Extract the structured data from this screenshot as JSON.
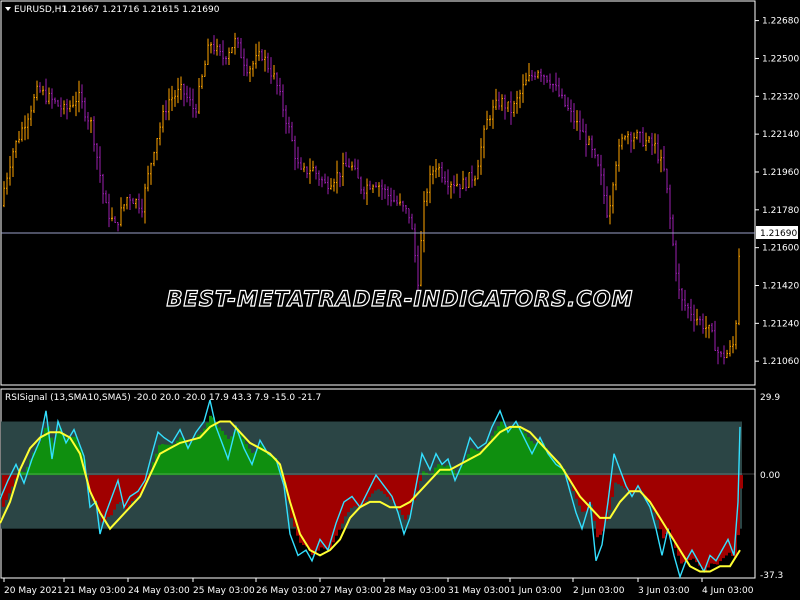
{
  "price_panel": {
    "symbol_title": "EURUSD,H1",
    "ohlc": "1.21667 1.21716 1.21615 1.21690",
    "current_price": "1.21690",
    "y_ticks": [
      "1.22680",
      "1.22500",
      "1.22320",
      "1.22140",
      "1.21960",
      "1.21780",
      "1.21600",
      "1.21420",
      "1.21240",
      "1.21060"
    ]
  },
  "indicator_panel": {
    "title": "RSISignal (13,SMA10,SMA5) -20.0 20.0 -20.0 17.9 43.3 7.9 -15.0 -21.7",
    "y_ticks": [
      "29.9",
      "0.00",
      "-37.3"
    ]
  },
  "time_axis": {
    "labels": [
      "20 May 2021",
      "21 May 03:00",
      "24 May 03:00",
      "25 May 03:00",
      "26 May 03:00",
      "27 May 03:00",
      "28 May 03:00",
      "31 May 03:00",
      "1 Jun 03:00",
      "2 Jun 03:00",
      "3 Jun 03:00",
      "4 Jun 03:00"
    ]
  },
  "watermark": "BEST-METATRADER-INDICATORS.COM",
  "colors": {
    "bull_bar": "#ffa500",
    "bear_bar": "#9b1fb0",
    "rsi_line": "#33e0ff",
    "signal_line": "#ffff33",
    "hist_pos": "#0f8f0f",
    "hist_neg": "#a00000",
    "band_fill": "#2b4545",
    "grid": "#ffffff"
  },
  "chart_data": {
    "type": "line",
    "title": "EURUSD,H1",
    "y_range": [
      1.2098,
      1.2274
    ],
    "close_profile": [
      [
        0,
        1.218
      ],
      [
        12,
        1.2205
      ],
      [
        25,
        1.222
      ],
      [
        38,
        1.2235
      ],
      [
        52,
        1.223
      ],
      [
        65,
        1.2225
      ],
      [
        78,
        1.2232
      ],
      [
        92,
        1.2218
      ],
      [
        105,
        1.218
      ],
      [
        115,
        1.217
      ],
      [
        128,
        1.2185
      ],
      [
        142,
        1.218
      ],
      [
        155,
        1.221
      ],
      [
        168,
        1.223
      ],
      [
        182,
        1.2235
      ],
      [
        195,
        1.2225
      ],
      [
        210,
        1.2258
      ],
      [
        222,
        1.225
      ],
      [
        235,
        1.2258
      ],
      [
        248,
        1.2245
      ],
      [
        262,
        1.2252
      ],
      [
        275,
        1.224
      ],
      [
        288,
        1.2218
      ],
      [
        300,
        1.2195
      ],
      [
        312,
        1.2198
      ],
      [
        325,
        1.219
      ],
      [
        338,
        1.2195
      ],
      [
        350,
        1.22
      ],
      [
        362,
        1.2188
      ],
      [
        375,
        1.2192
      ],
      [
        388,
        1.2185
      ],
      [
        400,
        1.218
      ],
      [
        410,
        1.2175
      ],
      [
        418,
        1.2145
      ],
      [
        425,
        1.2185
      ],
      [
        435,
        1.22
      ],
      [
        448,
        1.2192
      ],
      [
        462,
        1.219
      ],
      [
        475,
        1.2195
      ],
      [
        488,
        1.2222
      ],
      [
        500,
        1.223
      ],
      [
        512,
        1.2225
      ],
      [
        525,
        1.2238
      ],
      [
        538,
        1.2245
      ],
      [
        550,
        1.224
      ],
      [
        562,
        1.223
      ],
      [
        575,
        1.222
      ],
      [
        588,
        1.221
      ],
      [
        600,
        1.2195
      ],
      [
        608,
        1.2175
      ],
      [
        615,
        1.22
      ],
      [
        625,
        1.2215
      ],
      [
        640,
        1.2212
      ],
      [
        655,
        1.2208
      ],
      [
        665,
        1.2195
      ],
      [
        672,
        1.2165
      ],
      [
        680,
        1.2135
      ],
      [
        690,
        1.213
      ],
      [
        700,
        1.2125
      ],
      [
        710,
        1.212
      ],
      [
        720,
        1.2108
      ],
      [
        728,
        1.211
      ],
      [
        735,
        1.2115
      ],
      [
        740,
        1.2168
      ]
    ],
    "indicator": {
      "y_range": [
        -37.3,
        29.9
      ],
      "rsi_series": [
        [
          0,
          -9
        ],
        [
          8,
          -2
        ],
        [
          16,
          4
        ],
        [
          24,
          -3
        ],
        [
          32,
          6
        ],
        [
          40,
          13
        ],
        [
          46,
          24
        ],
        [
          52,
          6
        ],
        [
          58,
          20
        ],
        [
          66,
          12
        ],
        [
          74,
          17
        ],
        [
          84,
          7
        ],
        [
          90,
          -12
        ],
        [
          96,
          -10
        ],
        [
          100,
          -22
        ],
        [
          106,
          -14
        ],
        [
          112,
          -8
        ],
        [
          118,
          -2
        ],
        [
          124,
          -12
        ],
        [
          130,
          -8
        ],
        [
          138,
          -6
        ],
        [
          145,
          -2
        ],
        [
          152,
          8
        ],
        [
          158,
          16
        ],
        [
          164,
          14
        ],
        [
          172,
          12
        ],
        [
          180,
          17
        ],
        [
          188,
          10
        ],
        [
          196,
          16
        ],
        [
          204,
          20
        ],
        [
          210,
          28
        ],
        [
          216,
          18
        ],
        [
          222,
          12
        ],
        [
          228,
          6
        ],
        [
          236,
          18
        ],
        [
          244,
          10
        ],
        [
          252,
          4
        ],
        [
          260,
          13
        ],
        [
          268,
          8
        ],
        [
          276,
          6
        ],
        [
          284,
          -4
        ],
        [
          290,
          -22
        ],
        [
          298,
          -30
        ],
        [
          306,
          -28
        ],
        [
          312,
          -32
        ],
        [
          320,
          -24
        ],
        [
          328,
          -28
        ],
        [
          336,
          -18
        ],
        [
          344,
          -10
        ],
        [
          352,
          -8
        ],
        [
          360,
          -12
        ],
        [
          368,
          -6
        ],
        [
          376,
          0
        ],
        [
          384,
          -4
        ],
        [
          392,
          -8
        ],
        [
          398,
          -14
        ],
        [
          404,
          -22
        ],
        [
          410,
          -16
        ],
        [
          416,
          -4
        ],
        [
          422,
          8
        ],
        [
          430,
          2
        ],
        [
          436,
          8
        ],
        [
          442,
          4
        ],
        [
          448,
          6
        ],
        [
          455,
          -2
        ],
        [
          462,
          4
        ],
        [
          470,
          14
        ],
        [
          478,
          10
        ],
        [
          486,
          12
        ],
        [
          492,
          18
        ],
        [
          500,
          24
        ],
        [
          508,
          16
        ],
        [
          516,
          20
        ],
        [
          524,
          14
        ],
        [
          532,
          8
        ],
        [
          540,
          14
        ],
        [
          548,
          8
        ],
        [
          556,
          4
        ],
        [
          564,
          2
        ],
        [
          570,
          -6
        ],
        [
          576,
          -14
        ],
        [
          582,
          -20
        ],
        [
          590,
          -10
        ],
        [
          596,
          -32
        ],
        [
          602,
          -26
        ],
        [
          608,
          -10
        ],
        [
          614,
          8
        ],
        [
          620,
          2
        ],
        [
          626,
          -4
        ],
        [
          632,
          -8
        ],
        [
          638,
          -4
        ],
        [
          644,
          -8
        ],
        [
          650,
          -12
        ],
        [
          656,
          -20
        ],
        [
          662,
          -30
        ],
        [
          668,
          -20
        ],
        [
          674,
          -30
        ],
        [
          680,
          -38
        ],
        [
          686,
          -32
        ],
        [
          692,
          -28
        ],
        [
          698,
          -32
        ],
        [
          704,
          -36
        ],
        [
          710,
          -30
        ],
        [
          716,
          -32
        ],
        [
          722,
          -28
        ],
        [
          728,
          -24
        ],
        [
          734,
          -30
        ],
        [
          738,
          -10
        ],
        [
          740,
          18
        ]
      ],
      "signal_series": [
        [
          0,
          -18
        ],
        [
          10,
          -10
        ],
        [
          20,
          2
        ],
        [
          30,
          10
        ],
        [
          40,
          14
        ],
        [
          50,
          16
        ],
        [
          60,
          16
        ],
        [
          70,
          14
        ],
        [
          80,
          8
        ],
        [
          90,
          -6
        ],
        [
          100,
          -14
        ],
        [
          110,
          -20
        ],
        [
          120,
          -16
        ],
        [
          130,
          -12
        ],
        [
          140,
          -8
        ],
        [
          150,
          0
        ],
        [
          160,
          8
        ],
        [
          170,
          10
        ],
        [
          180,
          12
        ],
        [
          190,
          13
        ],
        [
          200,
          14
        ],
        [
          210,
          18
        ],
        [
          220,
          20
        ],
        [
          230,
          20
        ],
        [
          240,
          16
        ],
        [
          250,
          12
        ],
        [
          260,
          10
        ],
        [
          270,
          8
        ],
        [
          280,
          4
        ],
        [
          290,
          -10
        ],
        [
          300,
          -22
        ],
        [
          310,
          -28
        ],
        [
          320,
          -30
        ],
        [
          330,
          -28
        ],
        [
          340,
          -24
        ],
        [
          350,
          -16
        ],
        [
          360,
          -12
        ],
        [
          370,
          -10
        ],
        [
          380,
          -10
        ],
        [
          390,
          -12
        ],
        [
          400,
          -12
        ],
        [
          410,
          -10
        ],
        [
          420,
          -6
        ],
        [
          430,
          -2
        ],
        [
          440,
          2
        ],
        [
          450,
          2
        ],
        [
          460,
          4
        ],
        [
          470,
          6
        ],
        [
          480,
          8
        ],
        [
          490,
          12
        ],
        [
          500,
          16
        ],
        [
          510,
          18
        ],
        [
          520,
          18
        ],
        [
          530,
          16
        ],
        [
          540,
          12
        ],
        [
          550,
          8
        ],
        [
          560,
          4
        ],
        [
          570,
          -2
        ],
        [
          580,
          -8
        ],
        [
          590,
          -12
        ],
        [
          600,
          -16
        ],
        [
          610,
          -16
        ],
        [
          620,
          -10
        ],
        [
          630,
          -6
        ],
        [
          640,
          -6
        ],
        [
          650,
          -10
        ],
        [
          660,
          -16
        ],
        [
          670,
          -22
        ],
        [
          680,
          -28
        ],
        [
          690,
          -34
        ],
        [
          700,
          -36
        ],
        [
          710,
          -36
        ],
        [
          720,
          -34
        ],
        [
          730,
          -34
        ],
        [
          740,
          -28
        ]
      ],
      "band_range": [
        -20,
        20
      ]
    }
  }
}
